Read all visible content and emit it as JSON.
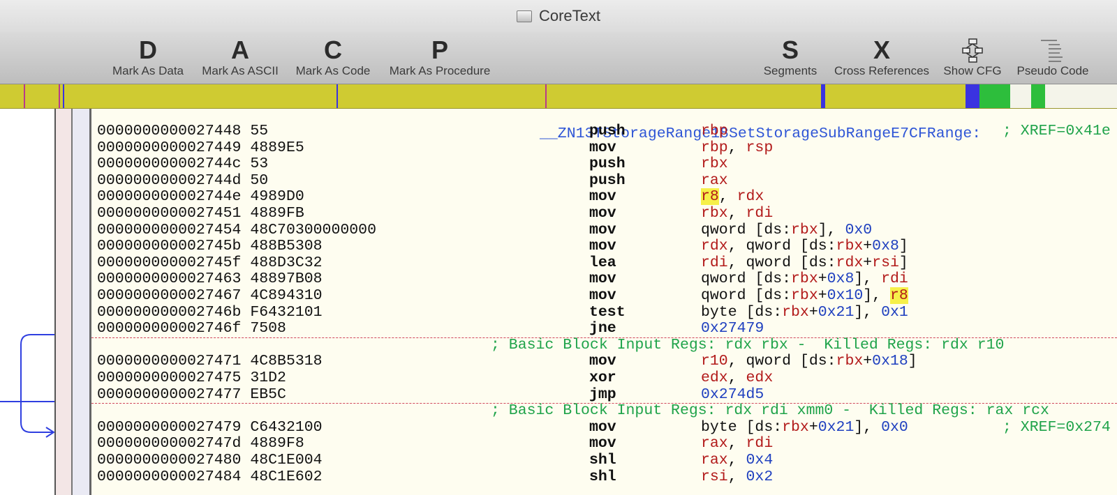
{
  "window": {
    "title": "CoreText"
  },
  "toolbar": {
    "buttons": [
      {
        "key": "D",
        "label": "Mark As Data"
      },
      {
        "key": "A",
        "label": "Mark As ASCII"
      },
      {
        "key": "C",
        "label": "Mark As Code"
      },
      {
        "key": "P",
        "label": "Mark As Procedure"
      },
      {
        "key": "S",
        "label": "Segments"
      },
      {
        "key": "X",
        "label": "Cross References"
      }
    ],
    "cfg_label": "Show CFG",
    "pseudo_label": "Pseudo Code",
    "cfg_icon": "flowchart-icon",
    "pseudo_icon": "pseudo-code-icon"
  },
  "colors": {
    "nav_strip": "#cfcb32",
    "nav_blue": "#3a33e0",
    "nav_green": "#2dbe3c",
    "register": "#b21a1a",
    "number": "#1e3fbf",
    "comment": "#1fa34a",
    "label": "#2e55d6"
  },
  "listing": {
    "procedure_label": "__ZN13TStorageRange18SetStorageSubRangeE7CFRange:",
    "lines": [
      {
        "addr": "0000000000027448",
        "bytes": "55",
        "mnemonic": "push",
        "operands": [
          [
            "reg",
            "rbp"
          ]
        ],
        "xref": "; XREF=0x41e"
      },
      {
        "addr": "0000000000027449",
        "bytes": "4889E5",
        "mnemonic": "mov",
        "operands": [
          [
            "reg",
            "rbp"
          ],
          [
            "txt",
            ", "
          ],
          [
            "reg",
            "rsp"
          ]
        ]
      },
      {
        "addr": "000000000002744c",
        "bytes": "53",
        "mnemonic": "push",
        "operands": [
          [
            "reg",
            "rbx"
          ]
        ]
      },
      {
        "addr": "000000000002744d",
        "bytes": "50",
        "mnemonic": "push",
        "operands": [
          [
            "reg",
            "rax"
          ]
        ]
      },
      {
        "addr": "000000000002744e",
        "bytes": "4989D0",
        "mnemonic": "mov",
        "operands": [
          [
            "hl",
            "r8"
          ],
          [
            "txt",
            ", "
          ],
          [
            "reg",
            "rdx"
          ]
        ]
      },
      {
        "addr": "0000000000027451",
        "bytes": "4889FB",
        "mnemonic": "mov",
        "operands": [
          [
            "reg",
            "rbx"
          ],
          [
            "txt",
            ", "
          ],
          [
            "reg",
            "rdi"
          ]
        ]
      },
      {
        "addr": "0000000000027454",
        "bytes": "48C70300000000",
        "mnemonic": "mov",
        "operands": [
          [
            "txt",
            "qword [ds:"
          ],
          [
            "reg",
            "rbx"
          ],
          [
            "txt",
            "], "
          ],
          [
            "num",
            "0x0"
          ]
        ]
      },
      {
        "addr": "000000000002745b",
        "bytes": "488B5308",
        "mnemonic": "mov",
        "operands": [
          [
            "reg",
            "rdx"
          ],
          [
            "txt",
            ", qword [ds:"
          ],
          [
            "reg",
            "rbx"
          ],
          [
            "txt",
            "+"
          ],
          [
            "num",
            "0x8"
          ],
          [
            "txt",
            "]"
          ]
        ]
      },
      {
        "addr": "000000000002745f",
        "bytes": "488D3C32",
        "mnemonic": "lea",
        "operands": [
          [
            "reg",
            "rdi"
          ],
          [
            "txt",
            ", qword [ds:"
          ],
          [
            "reg",
            "rdx"
          ],
          [
            "txt",
            "+"
          ],
          [
            "reg",
            "rsi"
          ],
          [
            "txt",
            "]"
          ]
        ]
      },
      {
        "addr": "0000000000027463",
        "bytes": "48897B08",
        "mnemonic": "mov",
        "operands": [
          [
            "txt",
            "qword [ds:"
          ],
          [
            "reg",
            "rbx"
          ],
          [
            "txt",
            "+"
          ],
          [
            "num",
            "0x8"
          ],
          [
            "txt",
            "], "
          ],
          [
            "reg",
            "rdi"
          ]
        ]
      },
      {
        "addr": "0000000000027467",
        "bytes": "4C894310",
        "mnemonic": "mov",
        "operands": [
          [
            "txt",
            "qword [ds:"
          ],
          [
            "reg",
            "rbx"
          ],
          [
            "txt",
            "+"
          ],
          [
            "num",
            "0x10"
          ],
          [
            "txt",
            "], "
          ],
          [
            "hl",
            "r8"
          ]
        ]
      },
      {
        "addr": "000000000002746b",
        "bytes": "F6432101",
        "mnemonic": "test",
        "operands": [
          [
            "txt",
            "byte [ds:"
          ],
          [
            "reg",
            "rbx"
          ],
          [
            "txt",
            "+"
          ],
          [
            "num",
            "0x21"
          ],
          [
            "txt",
            "], "
          ],
          [
            "num",
            "0x1"
          ]
        ]
      },
      {
        "addr": "000000000002746f",
        "bytes": "7508",
        "mnemonic": "jne",
        "operands": [
          [
            "num",
            "0x27479"
          ]
        ]
      },
      {
        "separator": true,
        "comment": "; Basic Block Input Regs: rdx rbx -  Killed Regs: rdx r10"
      },
      {
        "addr": "0000000000027471",
        "bytes": "4C8B5318",
        "mnemonic": "mov",
        "operands": [
          [
            "reg",
            "r10"
          ],
          [
            "txt",
            ", qword [ds:"
          ],
          [
            "reg",
            "rbx"
          ],
          [
            "txt",
            "+"
          ],
          [
            "num",
            "0x18"
          ],
          [
            "txt",
            "]"
          ]
        ]
      },
      {
        "addr": "0000000000027475",
        "bytes": "31D2",
        "mnemonic": "xor",
        "operands": [
          [
            "reg",
            "edx"
          ],
          [
            "txt",
            ", "
          ],
          [
            "reg",
            "edx"
          ]
        ]
      },
      {
        "addr": "0000000000027477",
        "bytes": "EB5C",
        "mnemonic": "jmp",
        "operands": [
          [
            "num",
            "0x274d5"
          ]
        ]
      },
      {
        "separator": true,
        "comment": "; Basic Block Input Regs: rdx rdi xmm0 -  Killed Regs: rax rcx"
      },
      {
        "addr": "0000000000027479",
        "bytes": "C6432100",
        "mnemonic": "mov",
        "operands": [
          [
            "txt",
            "byte [ds:"
          ],
          [
            "reg",
            "rbx"
          ],
          [
            "txt",
            "+"
          ],
          [
            "num",
            "0x21"
          ],
          [
            "txt",
            "], "
          ],
          [
            "num",
            "0x0"
          ]
        ],
        "xref": "; XREF=0x274"
      },
      {
        "addr": "000000000002747d",
        "bytes": "4889F8",
        "mnemonic": "mov",
        "operands": [
          [
            "reg",
            "rax"
          ],
          [
            "txt",
            ", "
          ],
          [
            "reg",
            "rdi"
          ]
        ]
      },
      {
        "addr": "0000000000027480",
        "bytes": "48C1E004",
        "mnemonic": "shl",
        "operands": [
          [
            "reg",
            "rax"
          ],
          [
            "txt",
            ", "
          ],
          [
            "num",
            "0x4"
          ]
        ]
      },
      {
        "addr": "0000000000027484",
        "bytes": "48C1E602",
        "mnemonic": "shl",
        "operands": [
          [
            "reg",
            "rsi"
          ],
          [
            "txt",
            ", "
          ],
          [
            "num",
            "0x2"
          ]
        ]
      }
    ]
  }
}
